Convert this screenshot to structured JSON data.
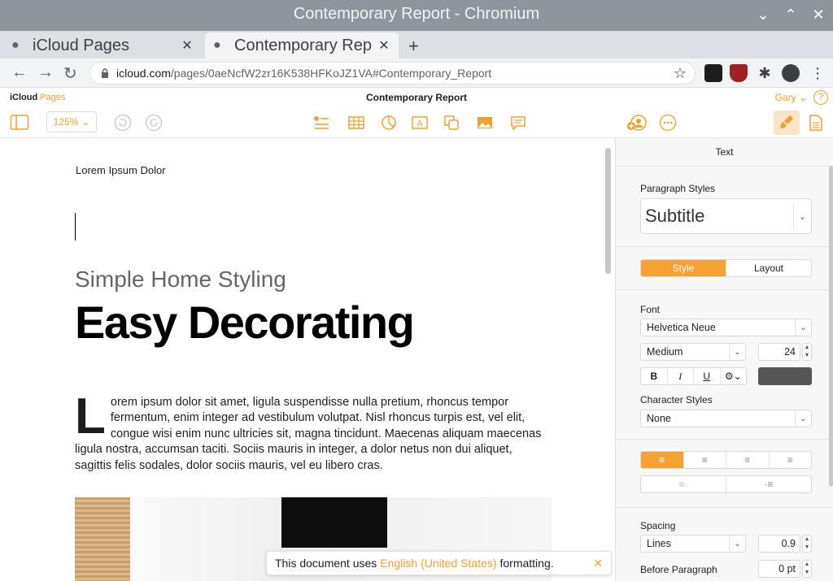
{
  "window": {
    "title": "Contemporary Report - Chromium"
  },
  "tabs": [
    {
      "title": "iCloud Pages"
    },
    {
      "title": "Contemporary Rep"
    }
  ],
  "address": {
    "host": "icloud.com",
    "path": "/pages/0aeNcfW2zr16K538HFKoJZ1VA#Contemporary_Report"
  },
  "app": {
    "brand_icloud": "iCloud",
    "brand_pages": "Pages",
    "doc_title": "Contemporary Report",
    "user": "Gary",
    "zoom": "125%"
  },
  "document": {
    "header": "Lorem Ipsum Dolor",
    "subtitle": "Simple Home Styling",
    "headline": "Easy Decorating",
    "dropcap": "L",
    "body": "orem ipsum dolor sit amet, ligula suspendisse nulla pretium, rhoncus tempor fermentum, enim integer ad vestibulum volutpat. Nisl rhoncus turpis est, vel elit, congue wisi enim nunc ultricies sit, magna tincidunt. Maecenas aliquam maecenas ligula nostra, accumsan taciti. Sociis mauris in integer, a dolor netus non dui aliquet, sagittis felis sodales, dolor sociis mauris, vel eu libero cras."
  },
  "toast": {
    "prefix": "This document uses",
    "language": "English (United States)",
    "suffix": "formatting."
  },
  "inspector": {
    "title": "Text",
    "paragraph_styles_label": "Paragraph Styles",
    "paragraph_style": "Subtitle",
    "tab_style": "Style",
    "tab_layout": "Layout",
    "font_label": "Font",
    "font_family": "Helvetica Neue",
    "font_weight": "Medium",
    "font_size": "24",
    "bold": "B",
    "italic": "I",
    "underline": "U",
    "character_styles_label": "Character Styles",
    "character_style": "None",
    "text_color": "#555555",
    "spacing_label": "Spacing",
    "spacing_mode": "Lines",
    "spacing_value": "0.9",
    "before_paragraph_label": "Before Paragraph",
    "before_paragraph_value": "0 pt"
  },
  "colors": {
    "accent": "#f0a030",
    "titlebar": "#8e969d"
  }
}
